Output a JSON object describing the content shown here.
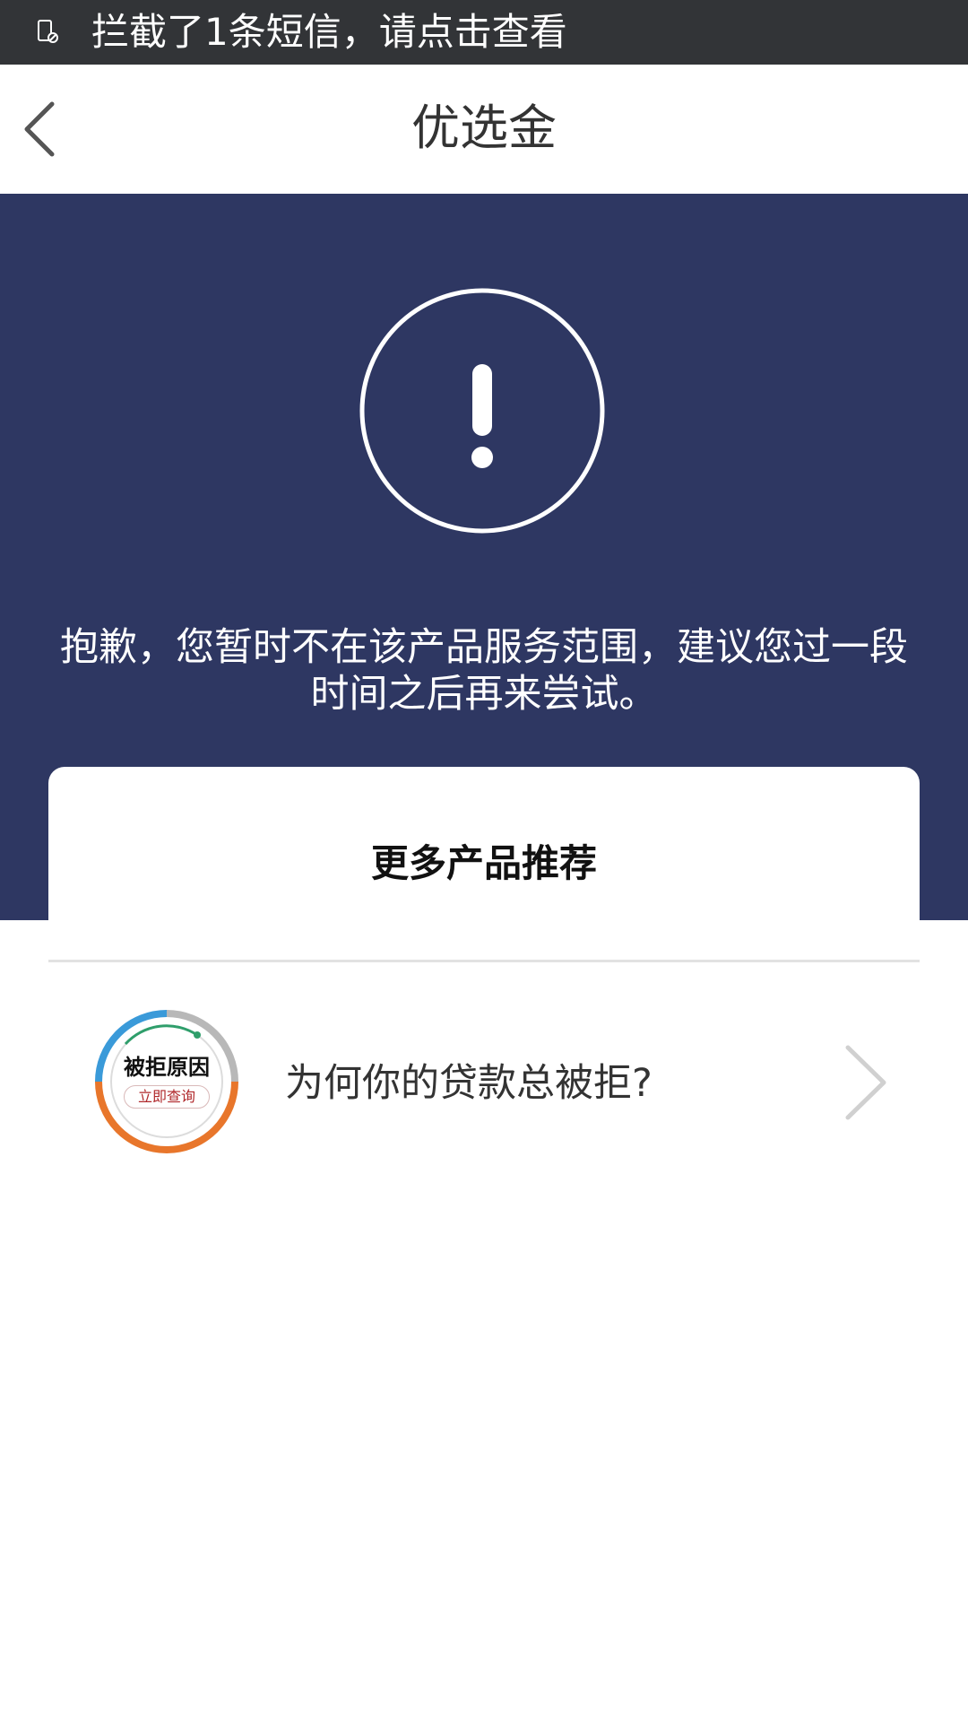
{
  "notification": {
    "text": "拦截了1条短信，请点击查看",
    "icon": "blocked-sms-icon"
  },
  "header": {
    "title": "优选金",
    "back_icon": "chevron-left-icon"
  },
  "hero": {
    "icon": "exclamation-circle-icon",
    "message": "抱歉，您暂时不在该产品服务范围，建议您过一段时间之后再来尝试。"
  },
  "recommendations": {
    "title": "更多产品推荐",
    "items": [
      {
        "badge_title": "被拒原因",
        "badge_subtitle": "立即查询",
        "label": "为何你的贷款总被拒?",
        "chevron_icon": "chevron-right-icon"
      }
    ]
  },
  "colors": {
    "notification_bg": "#323437",
    "hero_bg": "#2e3762",
    "badge_blue": "#3a9ad9",
    "badge_orange": "#e8762b",
    "badge_gray": "#b8b8b8",
    "badge_green": "#2f9e6b",
    "badge_text_red": "#b0282b"
  }
}
